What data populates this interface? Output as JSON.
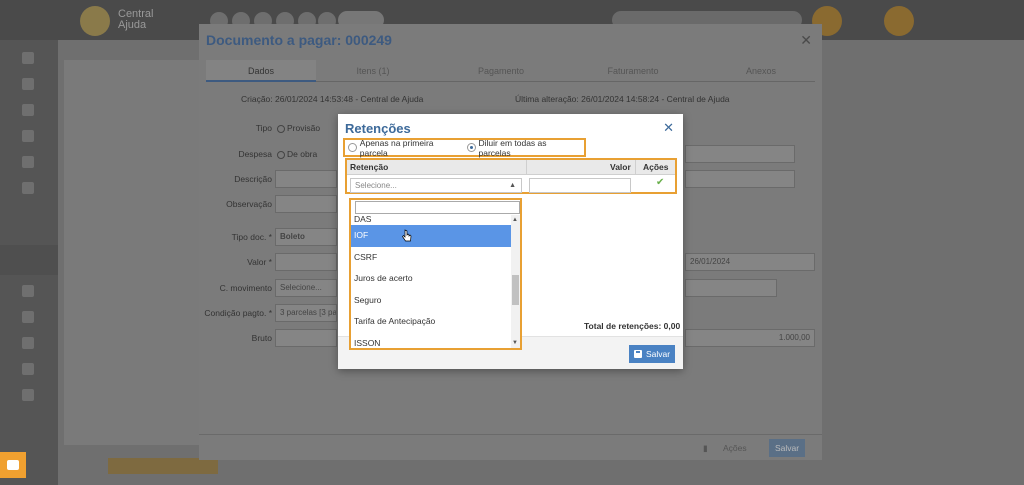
{
  "app": {
    "brand": "Central Ajuda"
  },
  "doc_modal": {
    "title": "Documento a pagar: 000249",
    "tabs": [
      "Dados",
      "Itens (1)",
      "Pagamento",
      "Faturamento",
      "Anexos"
    ],
    "creation": "Criação: 26/01/2024 14:53:48 - Central de Ajuda",
    "last_change": "Última alteração: 26/01/2024 14:58:24 - Central de Ajuda",
    "fields": {
      "tipo_label": "Tipo",
      "tipo_value": "Provisão",
      "despesa_label": "Despesa",
      "despesa_value": "De obra",
      "descricao_label": "Descrição",
      "observacao_label": "Observação",
      "tipo_doc_label": "Tipo doc. *",
      "tipo_doc_value": "Boleto",
      "valor_label": "Valor *",
      "c_movimento_label": "C. movimento",
      "c_movimento_placeholder": "Selecione...",
      "condicao_label": "Condição pagto. *",
      "condicao_value": "3 parcelas [3 pa",
      "bruto_label": "Bruto",
      "date_right": "26/01/2024",
      "bruto_right": "1.000,00"
    },
    "footer": {
      "acoes": "Ações",
      "salvar": "Salvar"
    }
  },
  "retencoes": {
    "title": "Retenções",
    "options": [
      "Apenas na primeira parcela",
      "Diluir em todas as parcelas"
    ],
    "selected_option": 1,
    "columns": {
      "retencao": "Retenção",
      "valor": "Valor",
      "acoes": "Ações"
    },
    "select_placeholder": "Selecione...",
    "total": "Total de retenções: 0,00",
    "save_label": "Salvar",
    "dropdown": {
      "search_value": "",
      "items": [
        "DAS",
        "IOF",
        "CSRF",
        "Juros de acerto",
        "Seguro",
        "Tarifa de Antecipação",
        "ISSON"
      ],
      "highlighted": "IOF"
    }
  }
}
